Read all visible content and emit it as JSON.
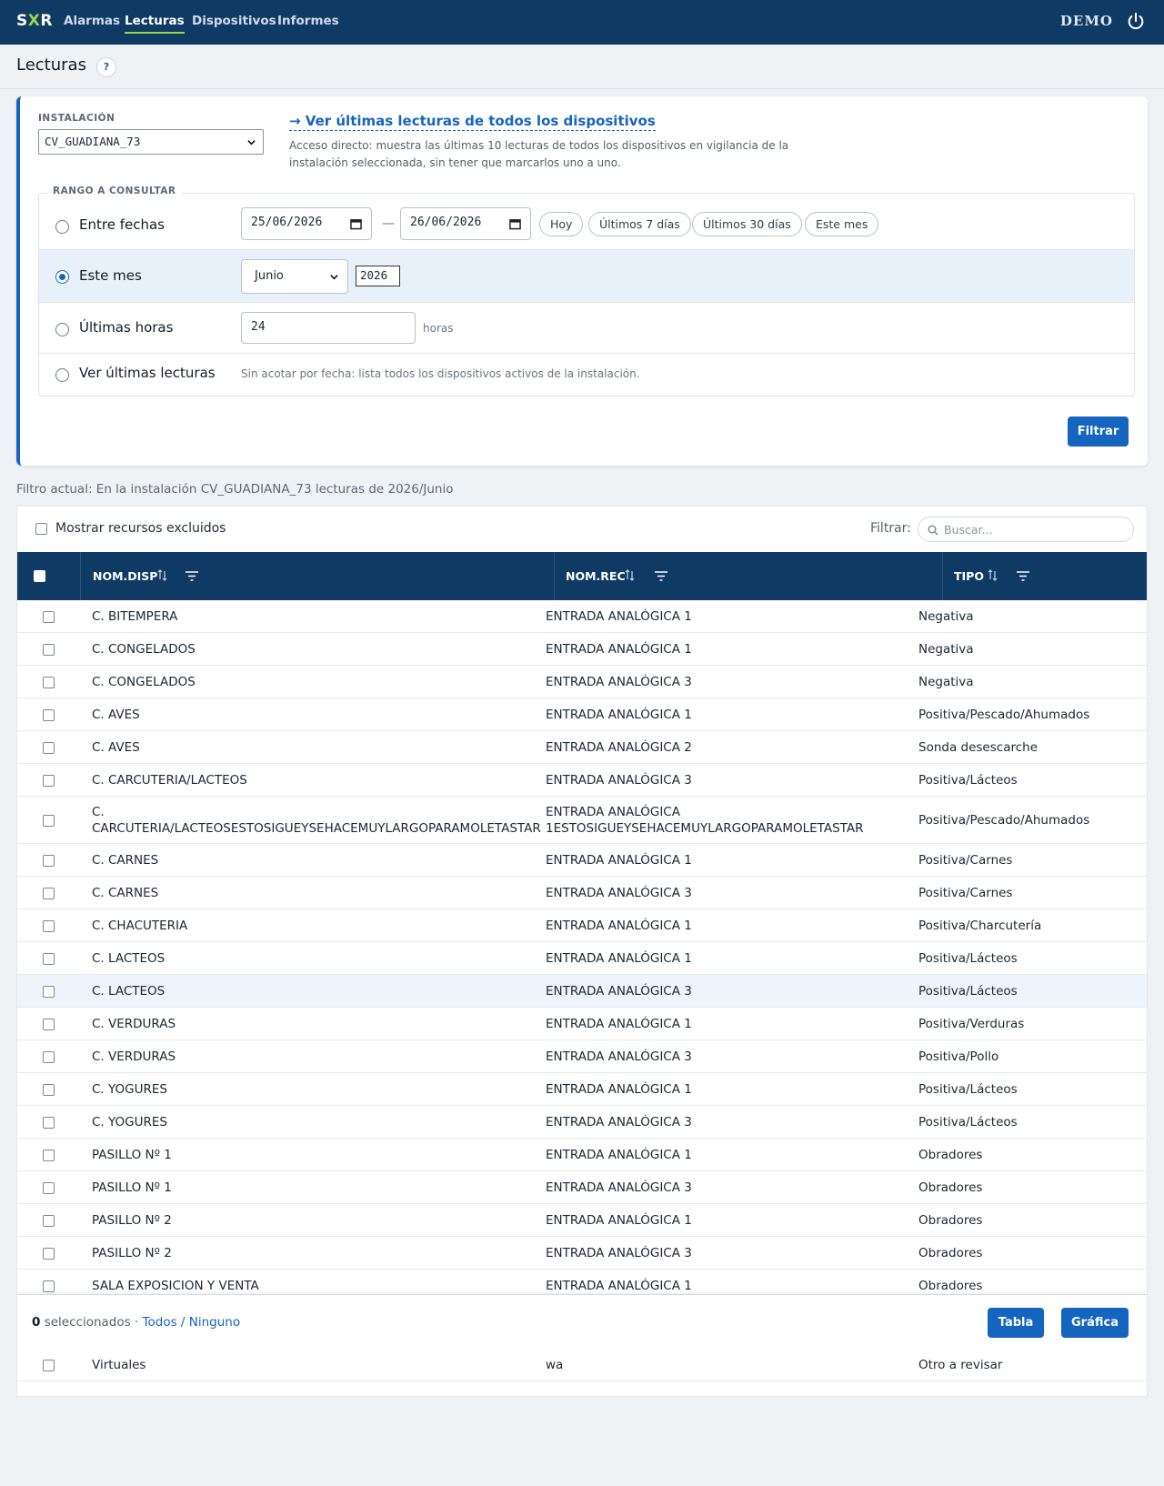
{
  "nav": {
    "logo_s": "S",
    "logo_x": "X",
    "logo_r": "R",
    "items": [
      {
        "label": "Alarmas"
      },
      {
        "label": "Lecturas"
      },
      {
        "label": "Dispositivos"
      },
      {
        "label": "Informes"
      }
    ],
    "active": "Lecturas",
    "user": "DEMO",
    "power_icon": "power-icon"
  },
  "page": {
    "title": "Lecturas",
    "help": "?"
  },
  "installation": {
    "label": "INSTALACIÓN",
    "value": "CV_GUADIANA_73",
    "link": "→ Ver últimas lecturas de todos los dispositivos",
    "description": "Acceso directo: muestra las últimas 10 lecturas de todos los dispositivos en vigilancia de la instalación seleccionada, sin tener que marcarlos uno a uno."
  },
  "range": {
    "legend": "RANGO A CONSULTAR",
    "selected": "Este mes",
    "between": {
      "label": "Entre fechas",
      "from": "25/06/2026",
      "to": "26/06/2026",
      "separator": "—"
    },
    "quick": [
      "Hoy",
      "Últimos 7 días",
      "Últimos 30 días",
      "Este mes"
    ],
    "month": {
      "label": "Este mes",
      "month": "Junio",
      "year": "2026"
    },
    "hours": {
      "label": "Últimas horas",
      "value": "24",
      "unit": "horas"
    },
    "latest": {
      "label": "Ver últimas lecturas",
      "note": "Sin acotar por fecha: lista todos los dispositivos activos de la instalación."
    },
    "submit": "Filtrar"
  },
  "current_filter": "Filtro actual: En la instalación CV_GUADIANA_73 lecturas de 2026/Junio",
  "table": {
    "show_excluded": "Mostrar recursos excluidos",
    "filter_label": "Filtrar:",
    "search_placeholder": "Buscar...",
    "columns": [
      "NOM.DISP",
      "NOM.REC",
      "TIPO"
    ],
    "rows": [
      {
        "disp": "C. BITEMPERA",
        "rec": "ENTRADA ANALÓGICA 1",
        "tipo": "Negativa"
      },
      {
        "disp": "C. CONGELADOS",
        "rec": "ENTRADA ANALÓGICA 1",
        "tipo": "Negativa"
      },
      {
        "disp": "C. CONGELADOS",
        "rec": "ENTRADA ANALÓGICA 3",
        "tipo": "Negativa"
      },
      {
        "disp": "C. AVES",
        "rec": "ENTRADA ANALÓGICA 1",
        "tipo": "Positiva/Pescado/Ahumados"
      },
      {
        "disp": "C. AVES",
        "rec": "ENTRADA ANALÓGICA 2",
        "tipo": "Sonda desescarche"
      },
      {
        "disp": "C. CARCUTERIA/LACTEOS",
        "rec": "ENTRADA ANALÓGICA 3",
        "tipo": "Positiva/Lácteos"
      },
      {
        "disp": "C. CARCUTERIA/LACTEOSESTOSIGUEYSEHACEMUYLARGOPARAMOLETASTAR",
        "rec": "ENTRADA ANALÓGICA 1ESTOSIGUEYSEHACEMUYLARGOPARAMOLETASTAR",
        "tipo": "Positiva/Pescado/Ahumados",
        "tall": true
      },
      {
        "disp": "C. CARNES",
        "rec": "ENTRADA ANALÓGICA 1",
        "tipo": "Positiva/Carnes"
      },
      {
        "disp": "C. CARNES",
        "rec": "ENTRADA ANALÓGICA 3",
        "tipo": "Positiva/Carnes"
      },
      {
        "disp": "C. CHACUTERIA",
        "rec": "ENTRADA ANALÓGICA 1",
        "tipo": "Positiva/Charcutería"
      },
      {
        "disp": "C. LACTEOS",
        "rec": "ENTRADA ANALÓGICA 1",
        "tipo": "Positiva/Lácteos"
      },
      {
        "disp": "C. LACTEOS",
        "rec": "ENTRADA ANALÓGICA 3",
        "tipo": "Positiva/Lácteos",
        "highlight": true
      },
      {
        "disp": "C. VERDURAS",
        "rec": "ENTRADA ANALÓGICA 1",
        "tipo": "Positiva/Verduras"
      },
      {
        "disp": "C. VERDURAS",
        "rec": "ENTRADA ANALÓGICA 3",
        "tipo": "Positiva/Pollo"
      },
      {
        "disp": "C. YOGURES",
        "rec": "ENTRADA ANALÓGICA 1",
        "tipo": "Positiva/Lácteos"
      },
      {
        "disp": "C. YOGURES",
        "rec": "ENTRADA ANALÓGICA 3",
        "tipo": "Positiva/Lácteos"
      },
      {
        "disp": "PASILLO Nº 1",
        "rec": "ENTRADA ANALÓGICA 1",
        "tipo": "Obradores"
      },
      {
        "disp": "PASILLO Nº 1",
        "rec": "ENTRADA ANALÓGICA 3",
        "tipo": "Obradores"
      },
      {
        "disp": "PASILLO Nº 2",
        "rec": "ENTRADA ANALÓGICA 1",
        "tipo": "Obradores"
      },
      {
        "disp": "PASILLO Nº 2",
        "rec": "ENTRADA ANALÓGICA 3",
        "tipo": "Obradores"
      },
      {
        "disp": "SALA EXPOSICION Y VENTA",
        "rec": "ENTRADA ANALÓGICA 1",
        "tipo": "Obradores"
      }
    ],
    "last_row": {
      "disp": "Virtuales",
      "rec": "wa",
      "tipo": "Otro a revisar"
    }
  },
  "footer": {
    "count": "0",
    "count_label": "seleccionados ·",
    "all": "Todos",
    "slash": "/",
    "none": "Ninguno",
    "table_button": "Tabla",
    "chart_button": "Gráfica"
  },
  "colors": {
    "brand": "#0e3a63",
    "accent": "#1565c0",
    "nav_active": "#9ad84a"
  }
}
